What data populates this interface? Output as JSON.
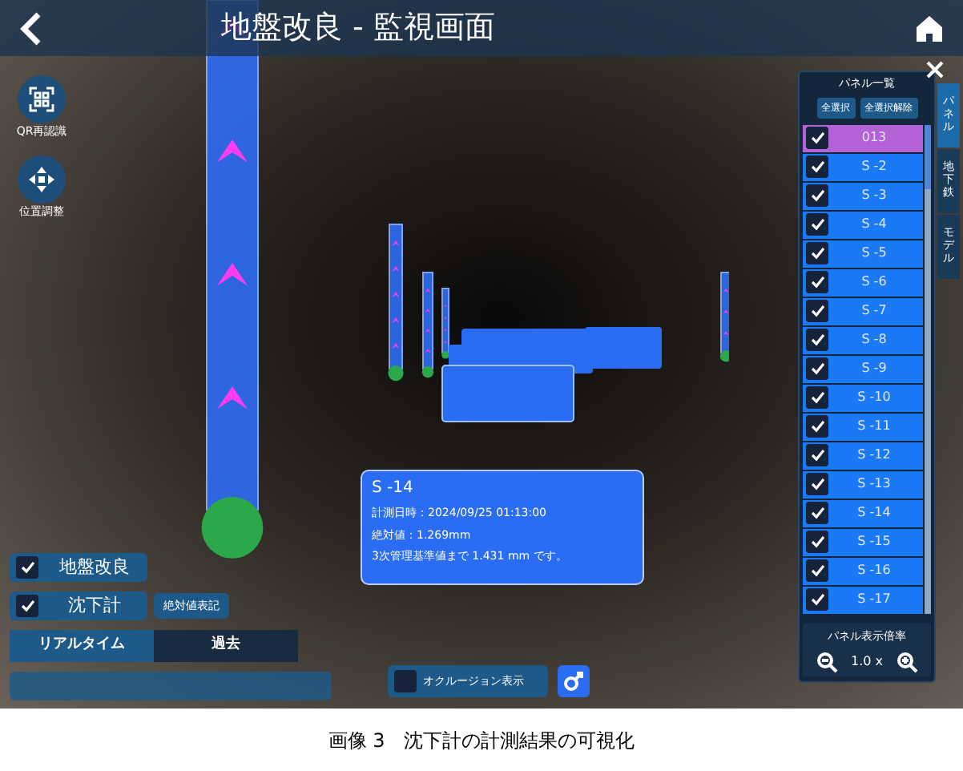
{
  "header": {
    "title": "地盤改良 - 監視画面"
  },
  "left_tools": [
    {
      "kind": "qr",
      "label": "QR再認識"
    },
    {
      "kind": "move",
      "label": "位置調整"
    }
  ],
  "layers": [
    {
      "label": "地盤改良",
      "checked": true
    },
    {
      "label": "沈下計",
      "checked": true
    }
  ],
  "absolute_button": "絶対値表記",
  "mode_tabs": [
    {
      "label": "リアルタイム",
      "selected": true
    },
    {
      "label": "過去",
      "selected": false
    }
  ],
  "occlusion": {
    "label": "オクルージョン表示",
    "checked": false
  },
  "info_card": {
    "title": "S -14",
    "lines": [
      "計測日時：2024/09/25 01:13:00",
      "絶対値：1.269mm",
      "3次管理基準値まで 1.431 mm です。"
    ]
  },
  "panel_list": {
    "title": "パネル一覧",
    "buttons": [
      "全選択",
      "全選択解除"
    ],
    "items": [
      {
        "label": "013",
        "checked": true,
        "selected": true
      },
      {
        "label": "S -2",
        "checked": true,
        "selected": false
      },
      {
        "label": "S -3",
        "checked": true,
        "selected": false
      },
      {
        "label": "S -4",
        "checked": true,
        "selected": false
      },
      {
        "label": "S -5",
        "checked": true,
        "selected": false
      },
      {
        "label": "S -6",
        "checked": true,
        "selected": false
      },
      {
        "label": "S -7",
        "checked": true,
        "selected": false
      },
      {
        "label": "S -8",
        "checked": true,
        "selected": false
      },
      {
        "label": "S -9",
        "checked": true,
        "selected": false
      },
      {
        "label": "S -10",
        "checked": true,
        "selected": false
      },
      {
        "label": "S -11",
        "checked": true,
        "selected": false
      },
      {
        "label": "S -12",
        "checked": true,
        "selected": false
      },
      {
        "label": "S -13",
        "checked": true,
        "selected": false
      },
      {
        "label": "S -14",
        "checked": true,
        "selected": false
      },
      {
        "label": "S -15",
        "checked": true,
        "selected": false
      },
      {
        "label": "S -16",
        "checked": true,
        "selected": false
      },
      {
        "label": "S -17",
        "checked": true,
        "selected": false
      }
    ],
    "scale": {
      "label": "パネル表示倍率",
      "value": "1.0 x"
    }
  },
  "side_tabs": [
    {
      "label": "パネル",
      "selected": true
    },
    {
      "label": "地下鉄",
      "selected": false
    },
    {
      "label": "モデル",
      "selected": false
    }
  ],
  "caption": "画像 3　沈下計の計測結果の可視化"
}
